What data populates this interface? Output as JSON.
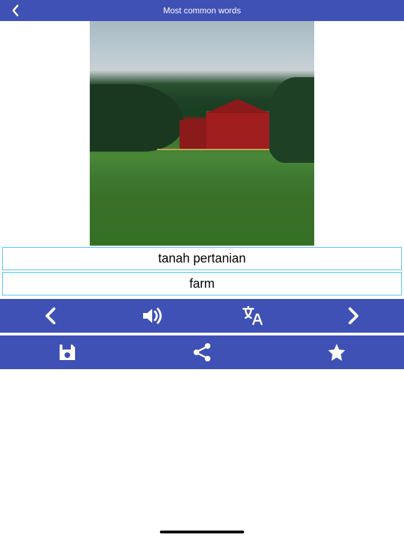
{
  "header": {
    "title": "Most common words"
  },
  "word": {
    "source": "tanah pertanian",
    "translation": "farm"
  },
  "image": {
    "alt": "farm"
  }
}
